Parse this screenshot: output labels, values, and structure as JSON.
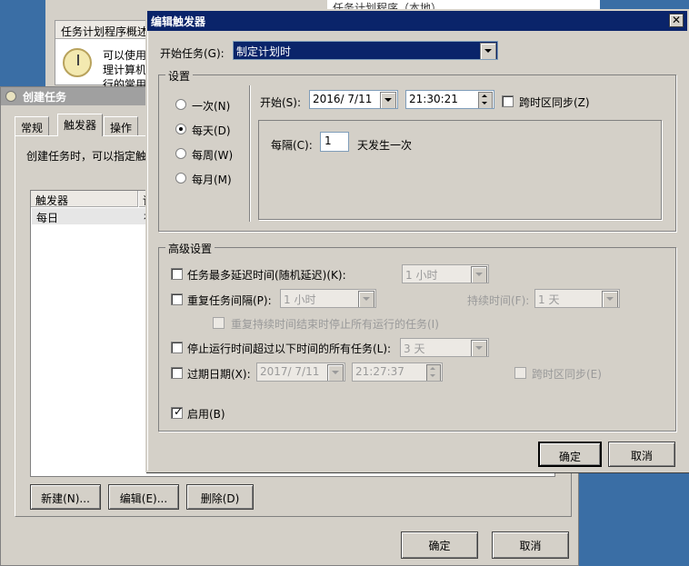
{
  "background_window": {
    "title": "任务计划程序（本地）",
    "overview_header": "任务计划程序概述",
    "desc_line1": "可以使用",
    "desc_line2": "理计算机",
    "desc_line3": "行的常用"
  },
  "create_task": {
    "title": "创建任务",
    "tabs": [
      "常规",
      "触发器",
      "操作"
    ],
    "intro": "创建任务时，可以指定触",
    "list_header": "触发器",
    "list_header2": "详",
    "rows": [
      {
        "trigger": "每日",
        "detail": "在"
      }
    ],
    "buttons": {
      "new": "新建(N)...",
      "edit": "编辑(E)...",
      "delete": "删除(D)",
      "ok": "确定",
      "cancel": "取消"
    }
  },
  "edit_trigger": {
    "title": "编辑触发器",
    "close_glyph": "✕",
    "begin_task_label": "开始任务(G):",
    "begin_task_value": "制定计划时",
    "settings_legend": "设置",
    "schedule_options": [
      {
        "label": "一次(N)",
        "selected": false
      },
      {
        "label": "每天(D)",
        "selected": true
      },
      {
        "label": "每周(W)",
        "selected": false
      },
      {
        "label": "每月(M)",
        "selected": false
      }
    ],
    "start_label": "开始(S):",
    "start_date": "2016/ 7/11",
    "start_time": "21:30:21",
    "sync_timezone_label": "跨时区同步(Z)",
    "recur_label": "每隔(C):",
    "recur_value": "1",
    "recur_suffix": "天发生一次",
    "advanced_legend": "高级设置",
    "delay_label": "任务最多延迟时间(随机延迟)(K):",
    "delay_value": "1 小时",
    "repeat_label": "重复任务间隔(P):",
    "repeat_value": "1 小时",
    "duration_label": "持续时间(F):",
    "duration_value": "1 天",
    "stop_running_label": "重复持续时间结束时停止所有运行的任务(I)",
    "stop_longer_label": "停止运行时间超过以下时间的所有任务(L):",
    "stop_longer_value": "3 天",
    "expire_label": "过期日期(X):",
    "expire_date": "2017/ 7/11",
    "expire_time": "21:27:37",
    "expire_sync_label": "跨时区同步(E)",
    "enabled_label": "启用(B)",
    "enabled": true,
    "ok": "确定",
    "cancel": "取消"
  }
}
